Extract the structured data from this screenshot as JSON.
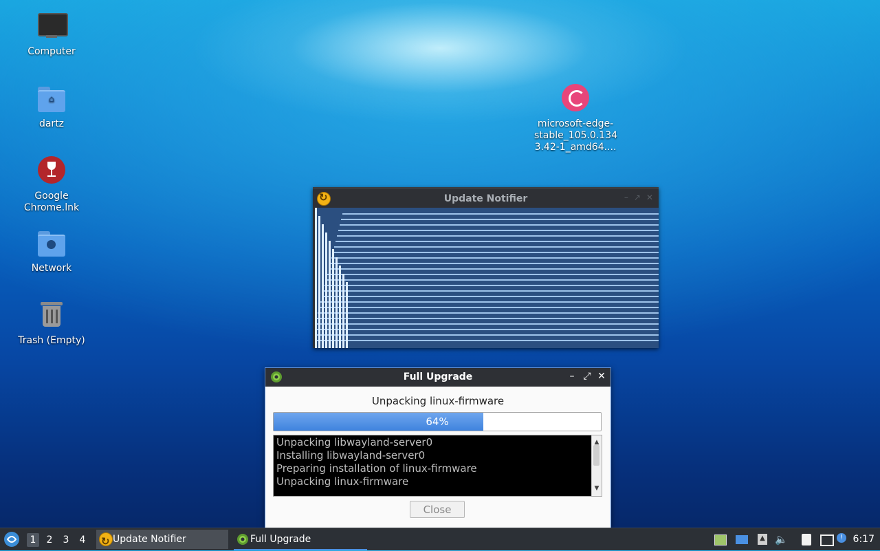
{
  "desktop": {
    "icons": [
      {
        "label": "Computer",
        "icon": "computer-icon"
      },
      {
        "label": "dartz",
        "icon": "home-folder-icon"
      },
      {
        "label": "Google\nChrome.lnk",
        "label_line1": "Google",
        "label_line2": "Chrome.lnk",
        "icon": "wine-icon"
      },
      {
        "label": "Network",
        "icon": "network-folder-icon"
      },
      {
        "label": "Trash (Empty)",
        "icon": "trash-icon"
      },
      {
        "label_line1": "microsoft-edge-",
        "label_line2": "stable_105.0.134",
        "label_line3": "3.42-1_amd64....",
        "icon": "debian-package-icon"
      }
    ]
  },
  "update_notifier_window": {
    "title": "Update Notifier",
    "icon": "update-notifier-icon"
  },
  "full_upgrade_window": {
    "title": "Full Upgrade",
    "icon": "gear-icon",
    "status": "Unpacking linux-firmware",
    "progress_value": 0.64,
    "progress_text": "64%",
    "log_lines": [
      "Unpacking libwayland-server0",
      "Installing libwayland-server0",
      "Preparing installation of linux-firmware",
      "Unpacking linux-firmware"
    ],
    "close_label": "Close",
    "controls": {
      "minimize": "–",
      "maximize": "⤢",
      "close": "✕"
    }
  },
  "taskbar": {
    "workspaces": [
      "1",
      "2",
      "3",
      "4"
    ],
    "active_workspace": "1",
    "tasks": [
      {
        "label": "Update Notifier",
        "icon": "update-notifier-icon"
      },
      {
        "label": "Full Upgrade",
        "icon": "gear-icon"
      }
    ],
    "tray_icons": [
      "battery-icon",
      "display-icon",
      "eject-icon",
      "volume-icon",
      "clipboard-icon",
      "network-icon",
      "notification-icon"
    ],
    "clock": "6:17"
  },
  "colors": {
    "accent": "#4a90e2",
    "titlebar": "#2e3035",
    "progress_fill": "#3f83de"
  }
}
